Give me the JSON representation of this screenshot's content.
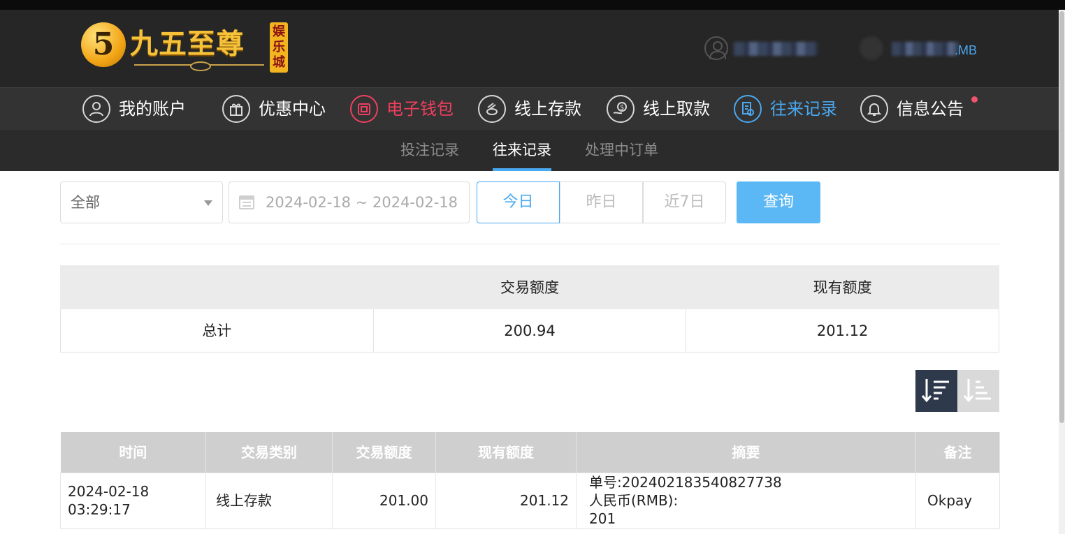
{
  "brand": {
    "logo_glyph": "5",
    "name": "九五至尊",
    "sub": "娱乐城"
  },
  "user": {
    "account_suffix": ".MB"
  },
  "nav": [
    {
      "label": "我的账户",
      "icon": "user-icon"
    },
    {
      "label": "优惠中心",
      "icon": "gift-icon"
    },
    {
      "label": "电子钱包",
      "icon": "wallet-icon"
    },
    {
      "label": "线上存款",
      "icon": "deposit-icon"
    },
    {
      "label": "线上取款",
      "icon": "withdraw-icon"
    },
    {
      "label": "往来记录",
      "icon": "records-icon"
    },
    {
      "label": "信息公告",
      "icon": "bell-icon"
    }
  ],
  "subtabs": [
    {
      "label": "投注记录"
    },
    {
      "label": "往来记录"
    },
    {
      "label": "处理中订单"
    }
  ],
  "filter": {
    "category": "全部",
    "date_range": "2024-02-18 ~ 2024-02-18",
    "day_buttons": [
      "今日",
      "昨日",
      "近7日"
    ],
    "query_label": "查询"
  },
  "summary": {
    "headers": [
      "",
      "交易额度",
      "现有额度"
    ],
    "total_label": "总计",
    "total_amount": "200.94",
    "total_balance": "201.12"
  },
  "records": {
    "headers": [
      "时间",
      "交易类别",
      "交易额度",
      "现有额度",
      "摘要",
      "备注"
    ],
    "rows": [
      {
        "time": "2024-02-18 03:29:17",
        "type": "线上存款",
        "amount": "201.00",
        "balance": "201.12",
        "summary_lines": [
          "单号:20240218354082773­8",
          "人民币(RMB):",
          "201"
        ],
        "note": "Okpay"
      }
    ]
  },
  "colors": {
    "accent": "#4aa8f0",
    "wallet_red": "#ef3f5f",
    "header_bg": "#262626",
    "nav_bg": "#333333"
  }
}
